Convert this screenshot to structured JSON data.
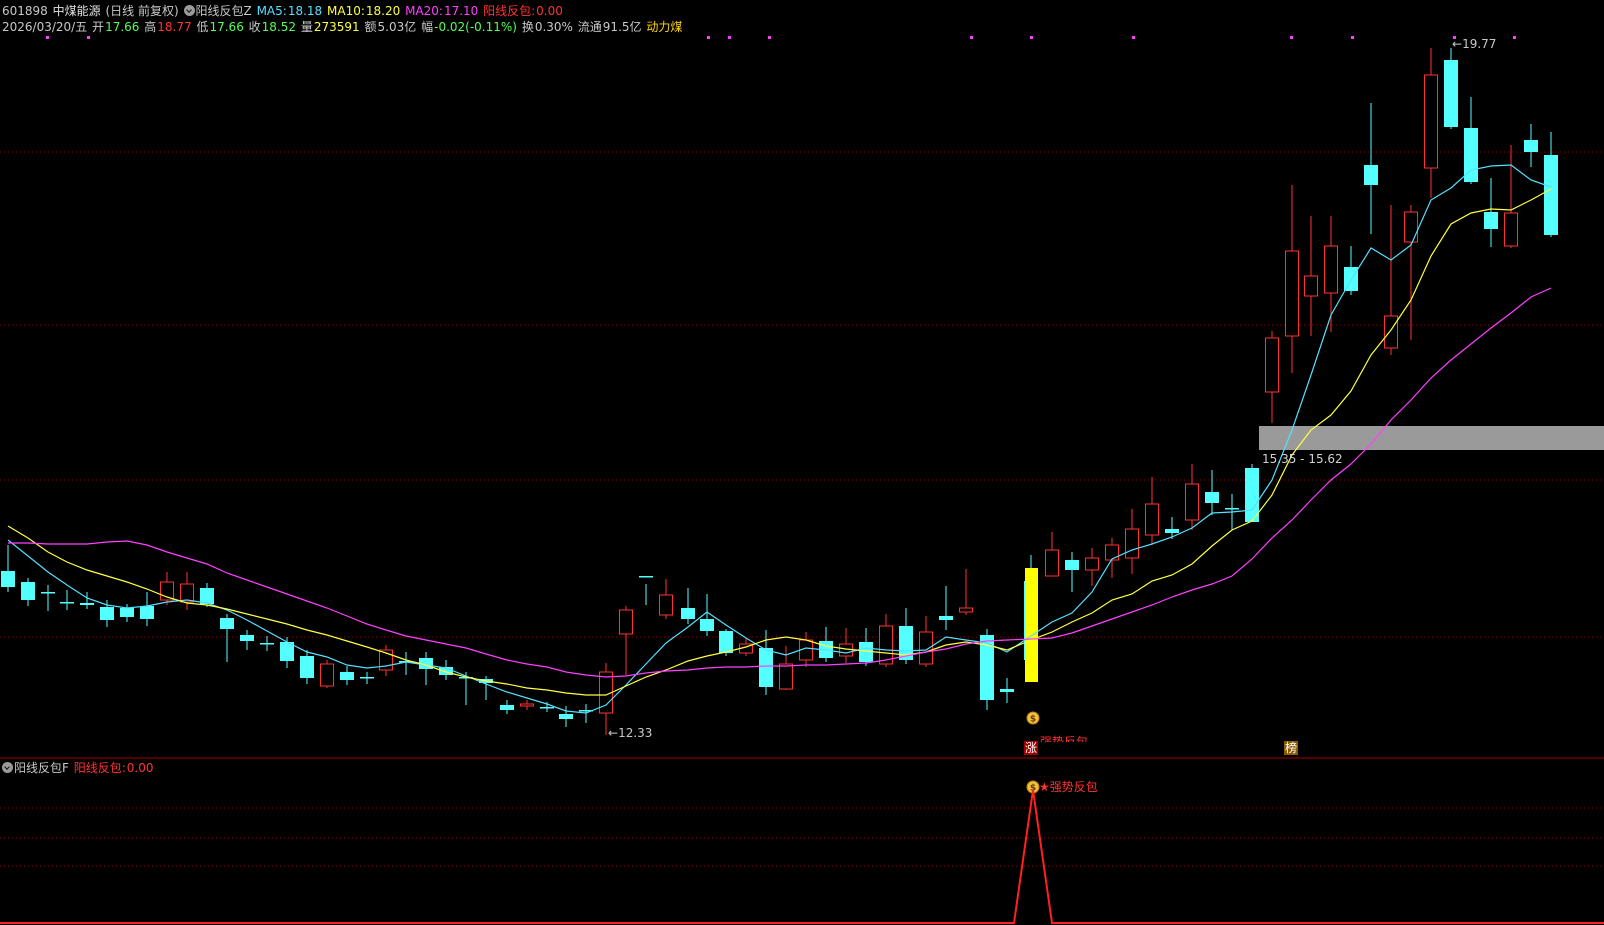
{
  "header": {
    "code": "601898",
    "name": "中煤能源",
    "period": "(日线 前复权)",
    "indicator_name": "阳线反包Z",
    "ma5_label": "MA5:",
    "ma5_value": "18.18",
    "ma10_label": "MA10:",
    "ma10_value": "18.20",
    "ma20_label": "MA20:",
    "ma20_value": "17.10",
    "signal_label": "阳线反包:",
    "signal_value": "0.00"
  },
  "quote": {
    "date": "2026/03/20/五",
    "open_label": "开",
    "open": "17.66",
    "high_label": "高",
    "high": "18.77",
    "low_label": "低",
    "low": "17.66",
    "close_label": "收",
    "close": "18.52",
    "vol_label": "量",
    "vol": "273591",
    "amt_label": "额",
    "amt": "5.03亿",
    "chg_label": "幅",
    "chg": "-0.02(-0.11%)",
    "turn_label": "换",
    "turn": "0.30%",
    "float_label": "流通",
    "float": "91.5亿",
    "sector": "动力煤"
  },
  "annotations": {
    "high_label": "19.77",
    "low_label": "12.33",
    "zone_label": "15.35 - 15.62",
    "signal_tag": "强势反包",
    "zhang": "涨",
    "bang": "榜",
    "money_icon": "money-bag-icon"
  },
  "sub": {
    "indicator_name": "阳线反包F",
    "signal_label": "阳线反包:",
    "signal_value": "0.00",
    "signal_tag": "强势反包"
  },
  "colors": {
    "up": "#ff3232",
    "down": "#54ffff",
    "ma5": "#54e0ff",
    "ma10": "#ffff40",
    "ma20": "#ff40ff",
    "grid": "#8a0000",
    "signal": "#ffff00",
    "zone": "#9a9a9a"
  }
}
